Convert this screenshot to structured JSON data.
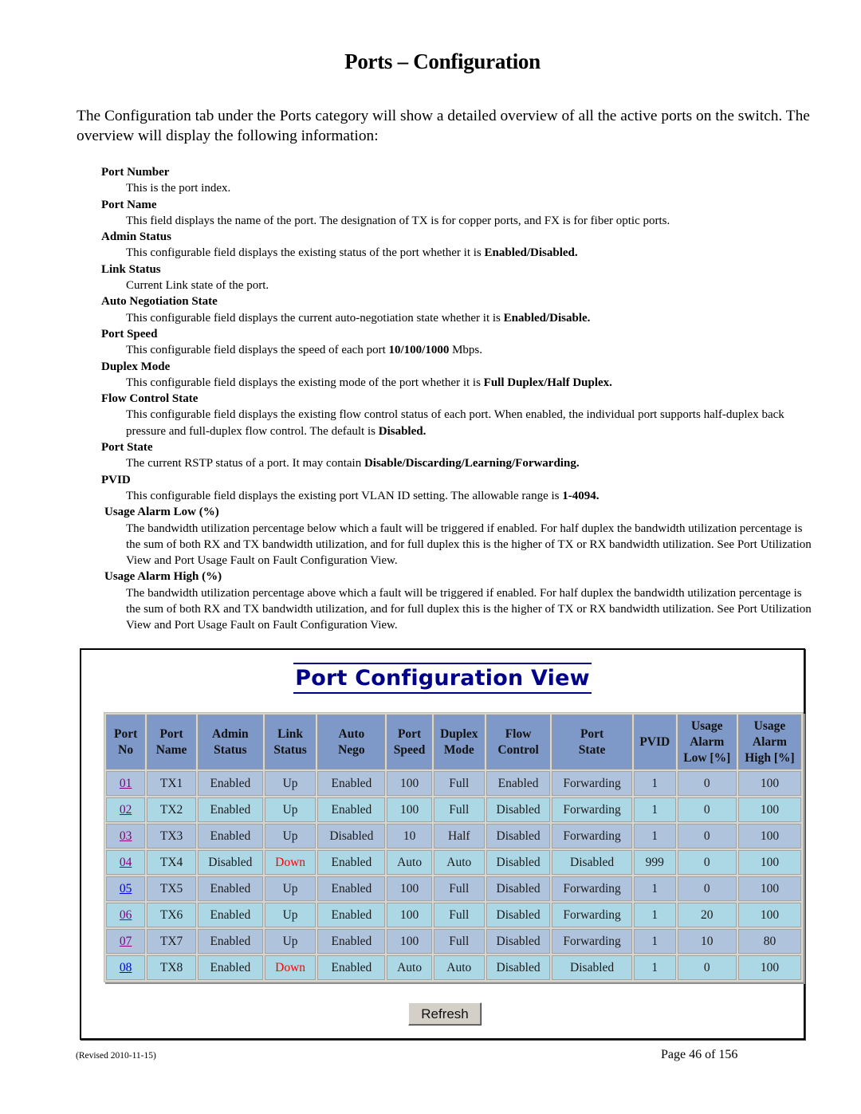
{
  "page_title": "Ports – Configuration",
  "intro": "The Configuration tab under the Ports category will show a detailed overview of all the active ports on the switch.  The overview will display the following information:",
  "fields": [
    {
      "name": "Port Number",
      "desc": [
        "This is the port index."
      ]
    },
    {
      "name": "Port Name",
      "desc": [
        "This field displays the name of the port. The designation of TX is for copper ports, and FX is for fiber optic ports."
      ]
    },
    {
      "name": "Admin Status",
      "desc": [
        "This configurable field displays the existing status of the port whether it is "
      ],
      "bold": "Enabled/Disabled."
    },
    {
      "name": "Link Status",
      "desc": [
        "Current Link state of the port."
      ]
    },
    {
      "name": "Auto Negotiation State",
      "desc": [
        "This configurable field displays the current auto-negotiation state whether it is "
      ],
      "bold": "Enabled/Disable."
    },
    {
      "name": "Port Speed",
      "desc": [
        "This configurable field displays the speed of each port "
      ],
      "bold": "10/100/1000",
      "after": " Mbps."
    },
    {
      "name": "Duplex Mode",
      "desc": [
        "This configurable field displays the existing mode of the port whether it is "
      ],
      "bold": "Full Duplex/Half Duplex."
    },
    {
      "name": "Flow Control State",
      "desc": [
        "This configurable field displays the existing flow control status of each port. When enabled, the individual port supports half-duplex back pressure and full-duplex flow control. The default is "
      ],
      "bold": "Disabled."
    },
    {
      "name": "Port State",
      "desc": [
        "The current RSTP status of a port. It may contain "
      ],
      "bold": "Disable/Discarding/Learning/Forwarding."
    },
    {
      "name": "PVID",
      "desc": [
        "This configurable field displays the existing port VLAN ID setting. The allowable range is "
      ],
      "bold": "1-4094."
    },
    {
      "name": "Usage Alarm Low (%)",
      "desc": [
        "The bandwidth utilization percentage below which a fault will be triggered if enabled. For half duplex the bandwidth utilization percentage is the sum of both RX and TX bandwidth utilization, and for full duplex this is the higher of TX or RX bandwidth utilization. See Port Utilization View and Port Usage Fault on Fault Configuration View."
      ]
    },
    {
      "name": "Usage Alarm High (%)",
      "desc": [
        "The bandwidth utilization percentage above which a fault will be triggered if enabled. For half duplex the bandwidth utilization percentage is the sum of both RX and TX bandwidth utilization, and for full duplex this is the higher of TX or RX bandwidth utilization. See Port Utilization View and Port Usage Fault on Fault Configuration View."
      ]
    }
  ],
  "view": {
    "title": "Port Configuration View",
    "columns": [
      [
        "Port",
        "No"
      ],
      [
        "Port",
        "Name"
      ],
      [
        "Admin",
        "Status"
      ],
      [
        "Link",
        "Status"
      ],
      [
        "Auto",
        "Nego"
      ],
      [
        "Port",
        "Speed"
      ],
      [
        "Duplex",
        "Mode"
      ],
      [
        "Flow",
        "Control"
      ],
      [
        "Port",
        "State"
      ],
      [
        "PVID"
      ],
      [
        "Usage",
        "Alarm",
        "Low [%]"
      ],
      [
        "Usage",
        "Alarm",
        "High [%]"
      ]
    ],
    "rows": [
      {
        "port_no": "01",
        "visited": true,
        "name": "TX1",
        "admin": "Enabled",
        "link": "Up",
        "nego": "Enabled",
        "speed": "100",
        "duplex": "Full",
        "flow": "Enabled",
        "state": "Forwarding",
        "pvid": "1",
        "low": "0",
        "high": "100"
      },
      {
        "port_no": "02",
        "visited": true,
        "name": "TX2",
        "admin": "Enabled",
        "link": "Up",
        "nego": "Enabled",
        "speed": "100",
        "duplex": "Full",
        "flow": "Disabled",
        "state": "Forwarding",
        "pvid": "1",
        "low": "0",
        "high": "100"
      },
      {
        "port_no": "03",
        "visited": true,
        "name": "TX3",
        "admin": "Enabled",
        "link": "Up",
        "nego": "Disabled",
        "speed": "10",
        "duplex": "Half",
        "flow": "Disabled",
        "state": "Forwarding",
        "pvid": "1",
        "low": "0",
        "high": "100"
      },
      {
        "port_no": "04",
        "visited": true,
        "name": "TX4",
        "admin": "Disabled",
        "link": "Down",
        "nego": "Enabled",
        "speed": "Auto",
        "duplex": "Auto",
        "flow": "Disabled",
        "state": "Disabled",
        "pvid": "999",
        "low": "0",
        "high": "100"
      },
      {
        "port_no": "05",
        "visited": false,
        "name": "TX5",
        "admin": "Enabled",
        "link": "Up",
        "nego": "Enabled",
        "speed": "100",
        "duplex": "Full",
        "flow": "Disabled",
        "state": "Forwarding",
        "pvid": "1",
        "low": "0",
        "high": "100"
      },
      {
        "port_no": "06",
        "visited": true,
        "name": "TX6",
        "admin": "Enabled",
        "link": "Up",
        "nego": "Enabled",
        "speed": "100",
        "duplex": "Full",
        "flow": "Disabled",
        "state": "Forwarding",
        "pvid": "1",
        "low": "20",
        "high": "100"
      },
      {
        "port_no": "07",
        "visited": true,
        "name": "TX7",
        "admin": "Enabled",
        "link": "Up",
        "nego": "Enabled",
        "speed": "100",
        "duplex": "Full",
        "flow": "Disabled",
        "state": "Forwarding",
        "pvid": "1",
        "low": "10",
        "high": "80"
      },
      {
        "port_no": "08",
        "visited": false,
        "name": "TX8",
        "admin": "Enabled",
        "link": "Down",
        "nego": "Enabled",
        "speed": "Auto",
        "duplex": "Auto",
        "flow": "Disabled",
        "state": "Disabled",
        "pvid": "1",
        "low": "0",
        "high": "100"
      }
    ],
    "refresh_label": "Refresh",
    "colors": {
      "header_bg": "#7e98c8",
      "row_odd_bg": "#b0c3dd",
      "row_even_bg": "#acd8e6",
      "link_down": "#ff0000",
      "title": "#00008b"
    }
  },
  "footer": {
    "revised": "(Revised 2010-11-15)",
    "page": "Page 46 of 156"
  }
}
